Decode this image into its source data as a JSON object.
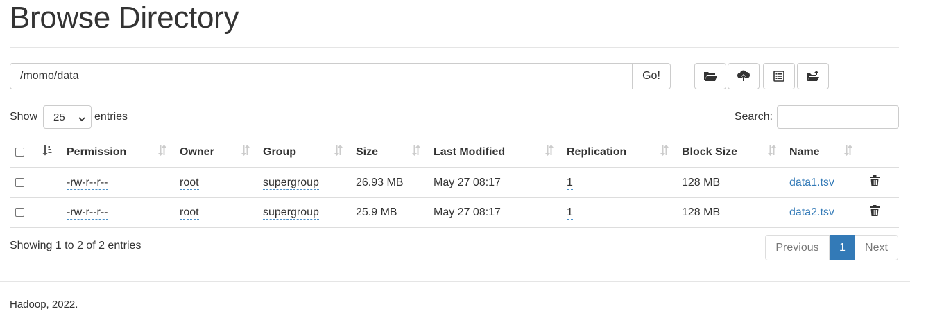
{
  "page": {
    "title": "Browse Directory"
  },
  "path_bar": {
    "value": "/momo/data",
    "go_label": "Go!"
  },
  "toolbar": [
    "folder-open-icon",
    "cloud-upload-icon",
    "list-alt-icon",
    "folder-upload-icon"
  ],
  "length": {
    "show_label": "Show",
    "selected": "25",
    "entries_label": "entries"
  },
  "search": {
    "label": "Search:",
    "value": ""
  },
  "table": {
    "headers": {
      "permission": "Permission",
      "owner": "Owner",
      "group": "Group",
      "size": "Size",
      "last_modified": "Last Modified",
      "replication": "Replication",
      "block_size": "Block Size",
      "name": "Name"
    },
    "rows": [
      {
        "permission": "-rw-r--r--",
        "owner": "root",
        "group": "supergroup",
        "size": "26.93 MB",
        "last_modified": "May 27 08:17",
        "replication": "1",
        "block_size": "128 MB",
        "name": "data1.tsv"
      },
      {
        "permission": "-rw-r--r--",
        "owner": "root",
        "group": "supergroup",
        "size": "25.9 MB",
        "last_modified": "May 27 08:17",
        "replication": "1",
        "block_size": "128 MB",
        "name": "data2.tsv"
      }
    ]
  },
  "info": {
    "text": "Showing 1 to 2 of 2 entries"
  },
  "pagination": {
    "previous": "Previous",
    "current": "1",
    "next": "Next"
  },
  "footer": {
    "text": "Hadoop, 2022."
  },
  "colors": {
    "link": "#337ab7",
    "active_page": "#337ab7",
    "border": "#dddddd"
  }
}
